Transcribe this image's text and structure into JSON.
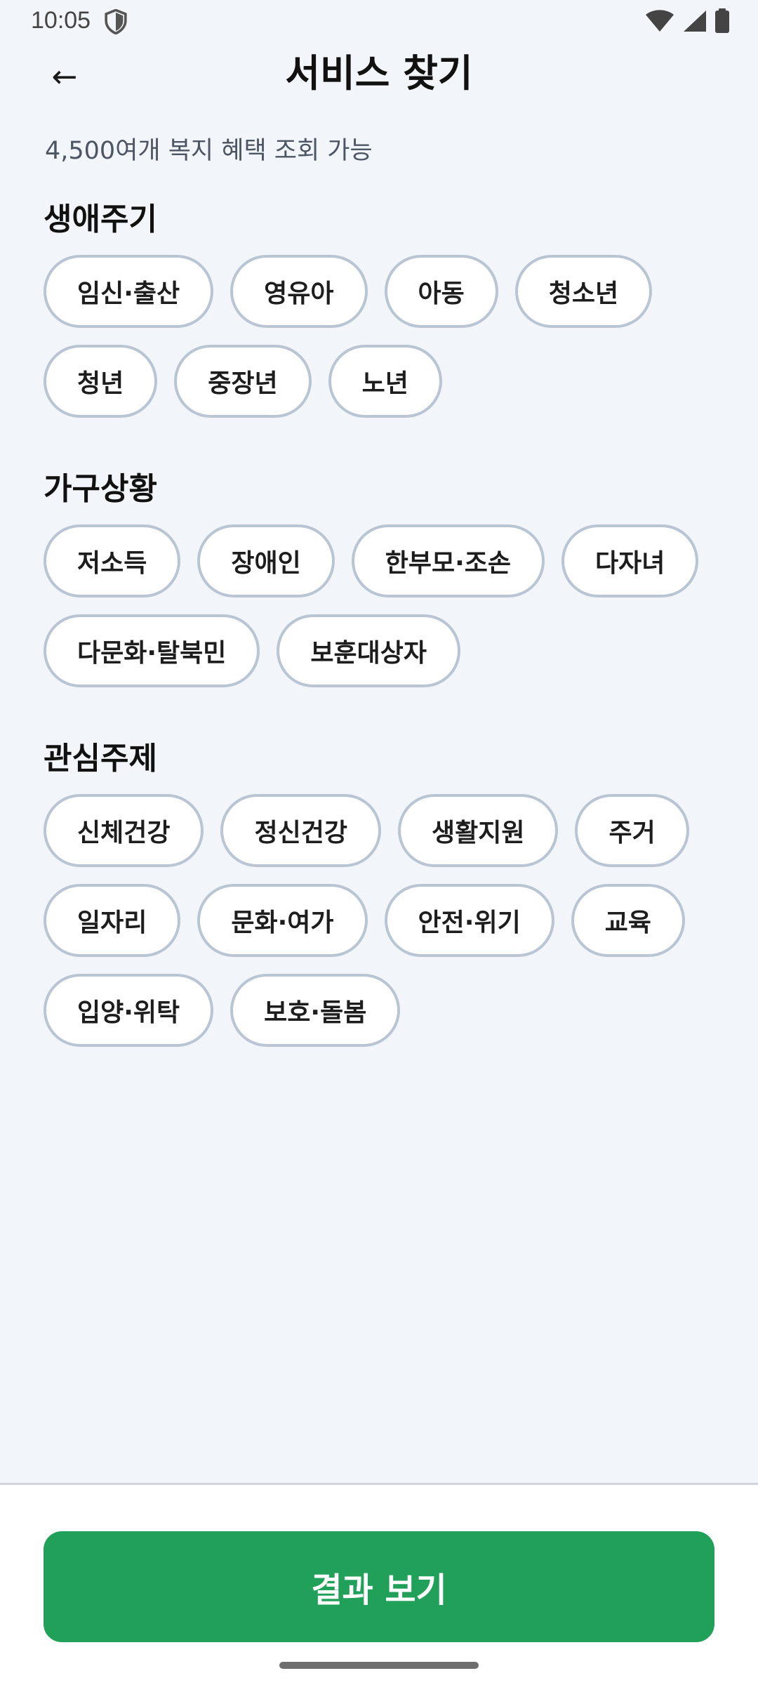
{
  "status_bar": {
    "time": "10:05",
    "icons": [
      "shield-icon",
      "wifi-icon",
      "signal-icon",
      "battery-icon"
    ]
  },
  "header": {
    "back_icon": "←",
    "title": "서비스 찾기"
  },
  "subtitle": "4,500여개 복지 혜택 조회 가능",
  "sections": {
    "life_cycle": {
      "title": "생애주기",
      "chips": [
        "임신·출산",
        "영유아",
        "아동",
        "청소년",
        "청년",
        "중장년",
        "노년"
      ]
    },
    "household": {
      "title": "가구상황",
      "chips": [
        "저소득",
        "장애인",
        "한부모·조손",
        "다자녀",
        "다문화·탈북민",
        "보훈대상자"
      ]
    },
    "interests": {
      "title": "관심주제",
      "chips": [
        "신체건강",
        "정신건강",
        "생활지원",
        "주거",
        "일자리",
        "문화·여가",
        "안전·위기",
        "교육",
        "입양·위탁",
        "보호·돌봄"
      ]
    }
  },
  "result_button": {
    "label": "결과 보기"
  },
  "colors": {
    "background": "#f2f5fa",
    "chip_border": "#b9c5d3",
    "accent": "#21a05a"
  }
}
